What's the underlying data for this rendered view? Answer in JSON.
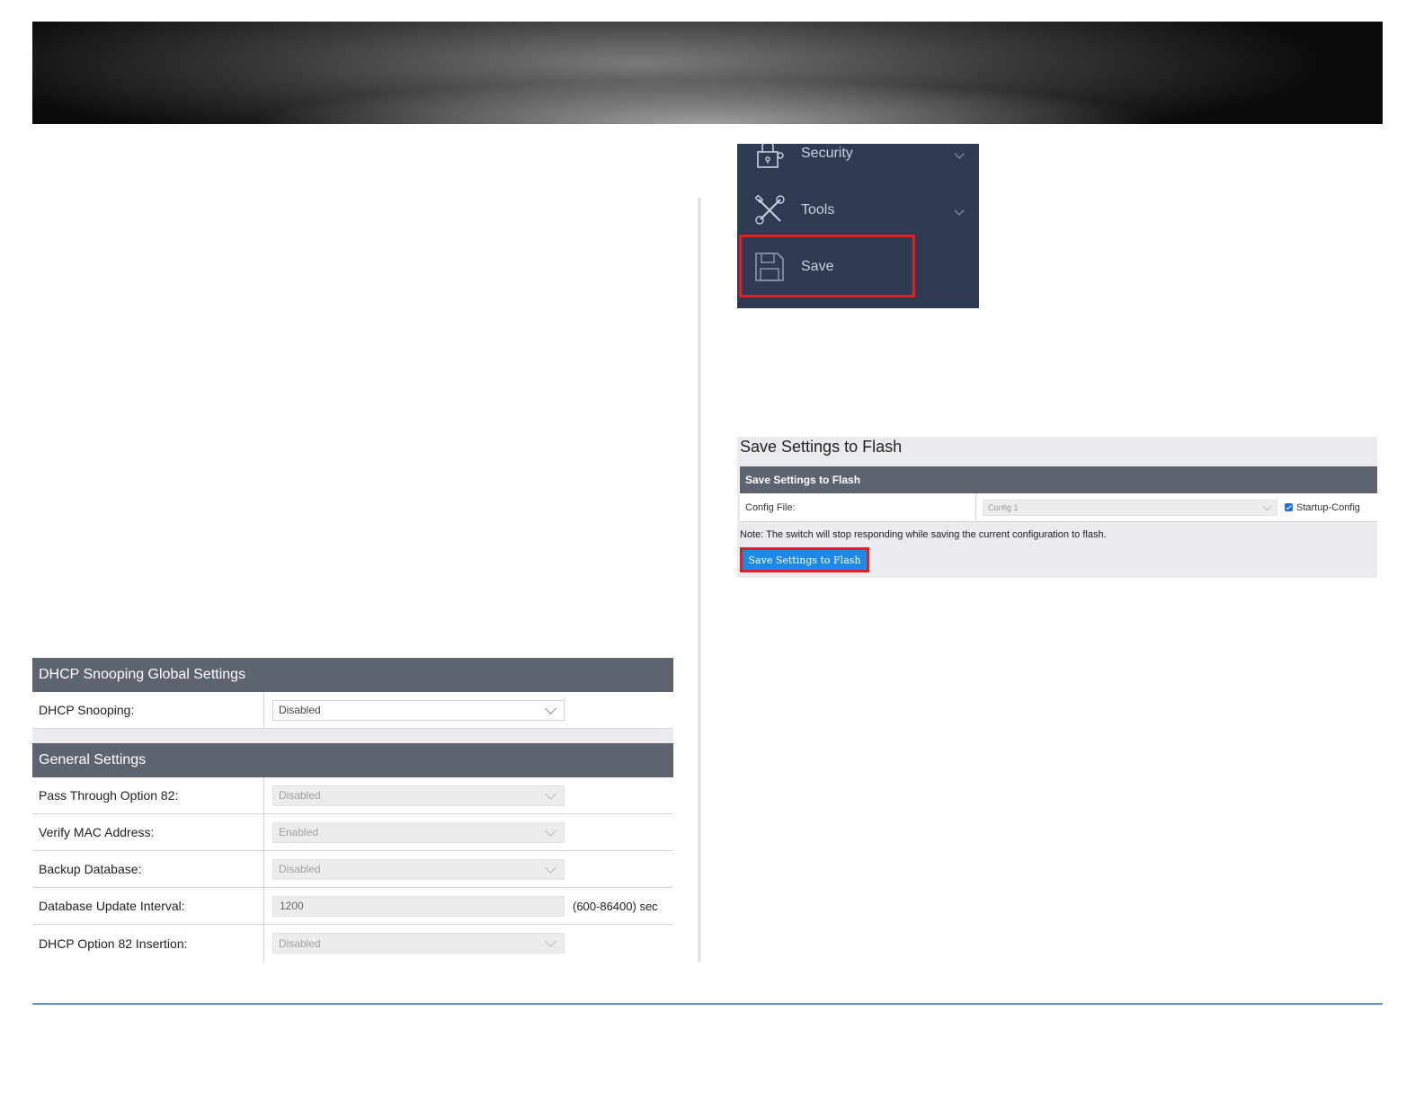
{
  "dhcp_snooping_global": {
    "header": "DHCP Snooping Global Settings",
    "dhcp_snooping_label": "DHCP Snooping:",
    "dhcp_snooping_value": "Disabled"
  },
  "general_settings": {
    "header": "General Settings",
    "rows": [
      {
        "label": "Pass Through Option 82:",
        "value": "Disabled"
      },
      {
        "label": "Verify MAC Address:",
        "value": "Enabled"
      },
      {
        "label": "Backup Database:",
        "value": "Disabled"
      },
      {
        "label": "Database Update Interval:",
        "value": "1200",
        "unit": "(600-86400) sec"
      },
      {
        "label": "DHCP Option 82 Insertion:",
        "value": "Disabled"
      }
    ]
  },
  "nav_menu": {
    "items": [
      {
        "label": "Security",
        "icon": "lock-icon"
      },
      {
        "label": "Tools",
        "icon": "tools-icon"
      },
      {
        "label": "Save",
        "icon": "floppy-disk-icon"
      }
    ],
    "highlight_color": "#e02020"
  },
  "save_settings": {
    "title": "Save Settings to Flash",
    "section_header": "Save Settings to Flash",
    "config_file_label": "Config File:",
    "config_file_value": "Config 1",
    "startup_config_label": "Startup-Config",
    "startup_config_checked": true,
    "note": "Note: The switch will stop responding while saving the current configuration to flash.",
    "button_label": "Save Settings to Flash",
    "button_color": "#1e88e5"
  }
}
